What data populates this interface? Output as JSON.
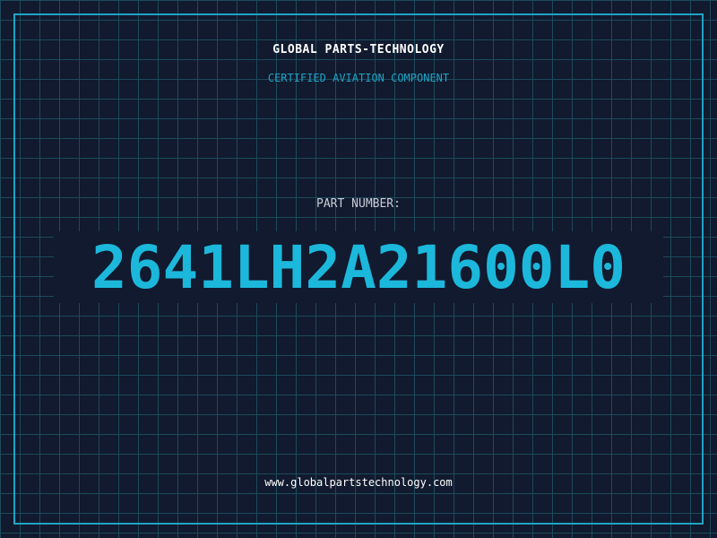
{
  "header": {
    "company": "GLOBAL PARTS-TECHNOLOGY",
    "tagline": "CERTIFIED AVIATION COMPONENT"
  },
  "part": {
    "label": "PART NUMBER:",
    "number": "2641LH2A21600L0"
  },
  "footer": {
    "url": "www.globalpartstechnology.com"
  },
  "colors": {
    "background": "#111a2e",
    "grid": "#1d4a5c",
    "accent": "#1fa3c4",
    "part_number": "#1cb8dc",
    "text_light": "#ffffff",
    "text_muted": "#c9ccd6"
  }
}
